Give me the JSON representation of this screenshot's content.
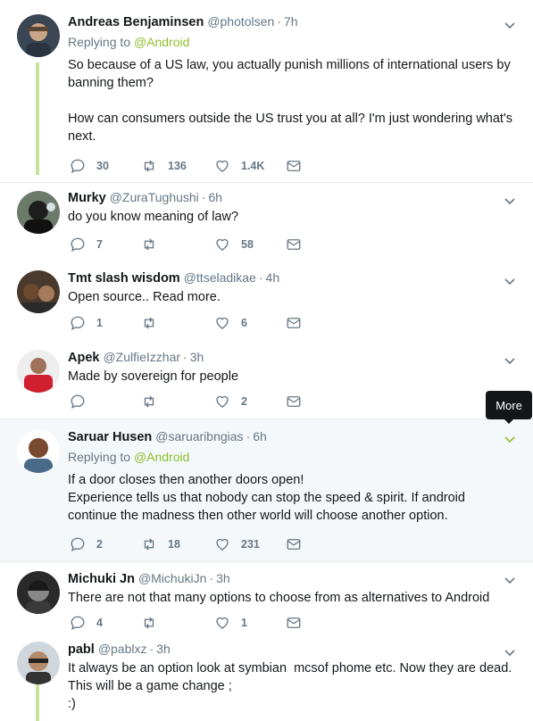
{
  "tooltip": "More",
  "tweets": [
    {
      "name": "Andreas Benjaminsen",
      "handle": "@photolsen",
      "time": "7h",
      "replying_prefix": "Replying to ",
      "replying_to": "@Android",
      "text": "So because of a US law, you actually punish millions of international users by banning them?\n\nHow can consumers outside the US trust you at all? I'm just wondering what's next.",
      "replies": "30",
      "retweets": "136",
      "likes": "1.4K"
    },
    {
      "name": "Murky",
      "handle": "@ZuraTughushi",
      "time": "6h",
      "text": "do you know meaning of law?",
      "replies": "7",
      "retweets": "",
      "likes": "58"
    },
    {
      "name": "Tmt slash wisdom",
      "handle": "@ttseladikae",
      "time": "4h",
      "text": "Open source.. Read more.",
      "replies": "1",
      "retweets": "",
      "likes": "6"
    },
    {
      "name": "Apek",
      "handle": "@ZulfieIzzhar",
      "time": "3h",
      "text": "Made by sovereign for people",
      "replies": "",
      "retweets": "",
      "likes": "2"
    },
    {
      "name": "Saruar Husen",
      "handle": "@saruaribngias",
      "time": "6h",
      "replying_prefix": "Replying to ",
      "replying_to": "@Android",
      "text": "If a door closes then another doors open!\nExperience tells us that nobody can stop the speed & spirit. If android continue the madness then other world will choose another option.",
      "replies": "2",
      "retweets": "18",
      "likes": "231"
    },
    {
      "name": "Michuki Jn",
      "handle": "@MichukiJn",
      "time": "3h",
      "text": "There are not that many options to choose from as alternatives to Android",
      "replies": "4",
      "retweets": "",
      "likes": "1"
    },
    {
      "name": "pabl",
      "handle": "@pablxz",
      "time": "3h",
      "text": "It always be an option look at symbian  mcsof phome etc. Now they are dead. This will be a game change ;\n:)",
      "replies": "",
      "retweets": "",
      "likes": ""
    }
  ],
  "colors": {
    "link": "#8fbf2d",
    "thread_line": "#c5e39b",
    "muted": "#657786",
    "highlight_bg": "#f5f8fa"
  }
}
